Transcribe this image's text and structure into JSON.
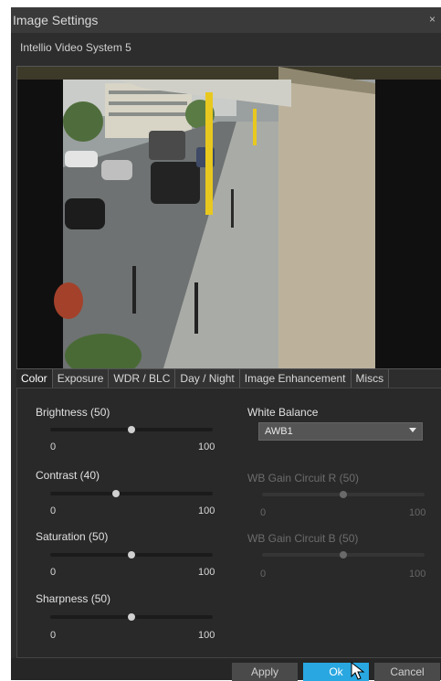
{
  "window": {
    "title": "Image Settings",
    "close_glyph": "×"
  },
  "device": {
    "name": "Intellio Video System 5"
  },
  "tabs": [
    {
      "label": "Color",
      "active": true
    },
    {
      "label": "Exposure"
    },
    {
      "label": "WDR / BLC"
    },
    {
      "label": "Day / Night"
    },
    {
      "label": "Image Enhancement"
    },
    {
      "label": "Miscs"
    }
  ],
  "color_panel": {
    "brightness": {
      "label": "Brightness (50)",
      "min": "0",
      "max": "100",
      "value": 50
    },
    "contrast": {
      "label": "Contrast (40)",
      "min": "0",
      "max": "100",
      "value": 40
    },
    "saturation": {
      "label": "Saturation (50)",
      "min": "0",
      "max": "100",
      "value": 50
    },
    "sharpness": {
      "label": "Sharpness (50)",
      "min": "0",
      "max": "100",
      "value": 50
    },
    "white_balance": {
      "label": "White Balance",
      "selected": "AWB1"
    },
    "wb_gain_r": {
      "label": "WB Gain Circuit R (50)",
      "min": "0",
      "max": "100",
      "value": 50,
      "enabled": false
    },
    "wb_gain_b": {
      "label": "WB Gain Circuit B (50)",
      "min": "0",
      "max": "100",
      "value": 50,
      "enabled": false
    }
  },
  "footer": {
    "apply_label": "Apply",
    "ok_label": "Ok",
    "cancel_label": "Cancel"
  },
  "colors": {
    "accent": "#29a7e1",
    "window_bg": "#2d2d2d",
    "titlebar": "#3a3a3a"
  }
}
